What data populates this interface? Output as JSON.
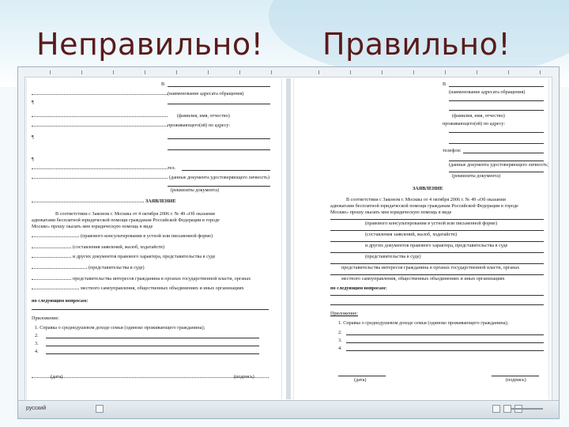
{
  "headings": {
    "left": "Неправильно!",
    "right": "Правильно!"
  },
  "status_bar": {
    "language": "русский"
  },
  "wrong_doc": {
    "to_label": "В",
    "position_label": "(наименование адресата обращения)",
    "name_label": "(фамилия, имя, отчество)",
    "address_label": "проживающего(ей) по адресу:",
    "phone_label": "тел.",
    "passport_label": "(данные документа удостоверяющего личность)",
    "doc_label": "(реквизиты документа)",
    "title": "ЗАЯВЛЕНИЕ",
    "body_1": "В соответствии с Законом г. Москвы от 4 октября 2006 г. № 49 «Об оказании",
    "body_2": "адвокатами бесплатной юридической помощи гражданам Российской Федерации в городе",
    "body_3": "Москве» прошу оказать мне юридическую помощь в виде",
    "opt_1": "(правового консультирования в устной или письменной форме)",
    "opt_2": "(составления заявлений, жалоб, ходатайств)",
    "opt_3": "и других документов правового характера, представительства в суде",
    "opt_4": "(представительства в суде)",
    "opt_5": "представительства интересов гражданина в органах государственной власти, органах",
    "opt_6": "местного самоуправления, общественных объединениях и иных организациях",
    "issue_label": "по следующим вопросам:",
    "attach_label": "Приложение:",
    "attach_1": "1. Справка о среднедушевом доходе семьи (одиноко проживающего гражданина);",
    "attach_2": "2.",
    "attach_3": "3.",
    "attach_4": "4.",
    "date_label": "(дата)",
    "sign_label": "(подпись)"
  },
  "right_doc": {
    "to_label": "В",
    "position_label": "(наименование адресата обращения)",
    "name_label": "(фамилия, имя, отчество)",
    "address_label": "проживающего(ей) по адресу:",
    "phone_label": "телефон:",
    "passport_label": "(данные документа удостоверяющего личность)",
    "doc_label": "(реквизиты документа)",
    "title": "ЗАЯВЛЕНИЕ",
    "body_1": "В соответствии с Законом г. Москвы от 4 октября 2006 г. № 49 «Об оказании",
    "body_2": "адвокатами бесплатной юридической помощи гражданам Российской Федерации в городе",
    "body_3": "Москве» прошу оказать мне юридическую помощь в виде",
    "opt_1": "(правового консультирования в устной или письменной форме)",
    "opt_2": "(составления заявлений, жалоб, ходатайств)",
    "opt_3": "и других документов правового характера, представительства в суде",
    "opt_4": "(представительства в суде)",
    "opt_5": "представительства интересов гражданина в органах государственной власти, органах",
    "opt_6": "местного самоуправления, общественных объединениях и иных организациях",
    "issue_label": "по следующим вопросам:",
    "attach_label": "Приложение:",
    "attach_1": "1. Справка о среднедушевом доходе семьи (одиноко проживающего гражданина);",
    "attach_2": "2.",
    "attach_3": "3.",
    "attach_4": "4.",
    "date_label": "(дата)",
    "sign_label": "(подпись)"
  }
}
